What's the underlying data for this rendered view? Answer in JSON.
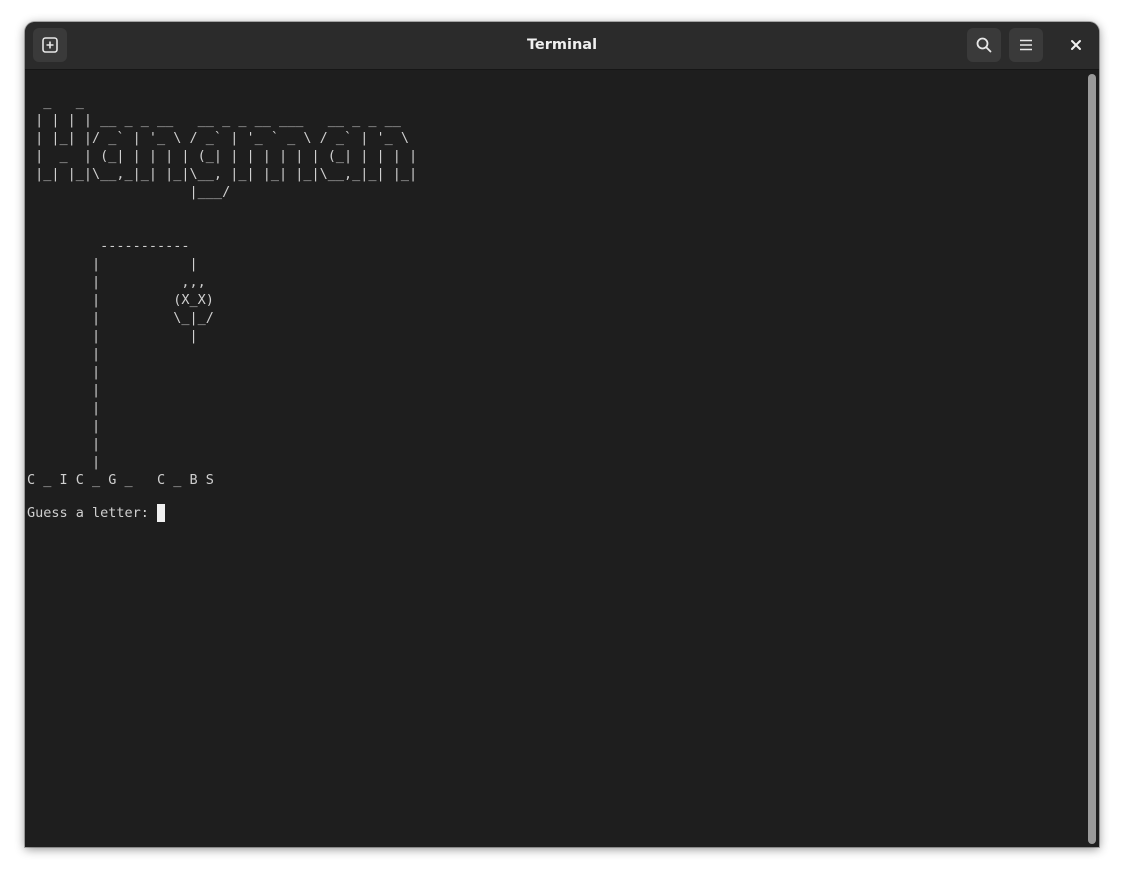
{
  "window": {
    "title": "Terminal"
  },
  "header": {
    "new_tab_icon": "new-tab-plus-icon",
    "search_icon": "search-icon",
    "menu_icon": "hamburger-menu-icon",
    "close_icon": "close-icon"
  },
  "terminal": {
    "banner_lines": [
      "  _   _",
      " | | | | __ _ _ __   __ _ _ __ ___   __ _ _ __",
      " | |_| |/ _` | '_ \\ / _` | '_ ` _ \\ / _` | '_ \\",
      " |  _  | (_| | | | | (_| | | | | | | (_| | | | |",
      " |_| |_|\\__,_|_| |_|\\__, |_| |_| |_|\\__,_|_| |_|",
      "                    |___/"
    ],
    "gallows_lines": [
      "",
      "",
      "         -----------",
      "        |           |",
      "        |          ,,,",
      "        |         (X_X)",
      "        |         \\_|_/",
      "        |           |",
      "        |",
      "        |",
      "        |",
      "        |",
      "        |",
      "        |",
      "        |"
    ],
    "word_progress": "C _ I C _ G _   C _ B S",
    "blank_line": "",
    "prompt": "Guess a letter: "
  }
}
